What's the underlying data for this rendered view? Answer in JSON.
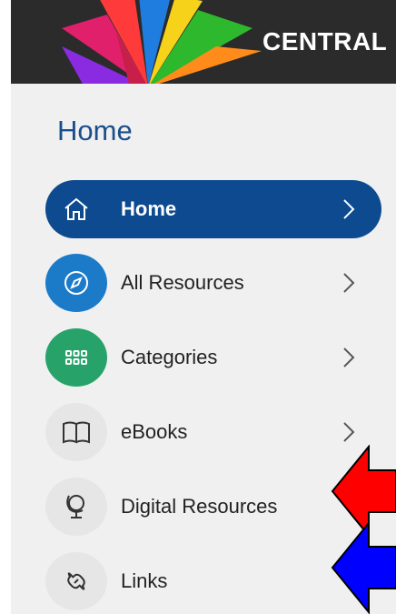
{
  "header": {
    "brand": "CENTRAL",
    "background": "#2b2b2b"
  },
  "section": {
    "title": "Home"
  },
  "nav": {
    "items": [
      {
        "label": "Home",
        "icon": "house-icon",
        "active": true,
        "color": "#0d4a8f",
        "has_chevron": true
      },
      {
        "label": "All Resources",
        "icon": "compass-icon",
        "active": false,
        "color": "#1b7bc9",
        "has_chevron": true
      },
      {
        "label": "Categories",
        "icon": "grid-icon",
        "active": false,
        "color": "#27a36a",
        "has_chevron": true
      },
      {
        "label": "eBooks",
        "icon": "book-icon",
        "active": false,
        "color": "#e6e6e6",
        "has_chevron": true
      },
      {
        "label": "Digital Resources",
        "icon": "globe-icon",
        "active": false,
        "color": "#e6e6e6",
        "has_chevron": false
      },
      {
        "label": "Links",
        "icon": "link-icon",
        "active": false,
        "color": "#e6e6e6",
        "has_chevron": false
      }
    ]
  },
  "annotations": [
    {
      "type": "arrow",
      "color": "#ff0000",
      "points_to": "Digital Resources"
    },
    {
      "type": "arrow",
      "color": "#0000ff",
      "points_to": "Links"
    }
  ]
}
